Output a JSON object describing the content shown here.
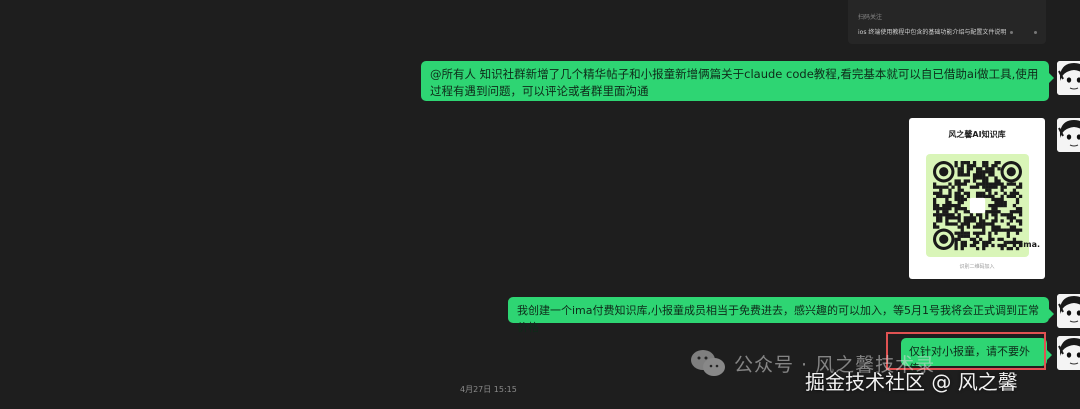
{
  "colors": {
    "bubble": "#2ed573",
    "background": "#1e1e1e",
    "highlight": "#e05252"
  },
  "link_card": {
    "source": "扫码关注",
    "title": "ios 终端使用教程中包含的基础功能介绍与配置文件说明"
  },
  "messages": [
    {
      "type": "text",
      "text": "@所有人 知识社群新增了几个精华帖子和小报童新增俩篇关于claude code教程,看完基本就可以自已借助ai做工具,使用过程有遇到问题，可以评论或者群里面沟通"
    },
    {
      "type": "image",
      "qr_title": "风之馨AI知识库",
      "logo": "ima.",
      "footer": "识别二维码加入"
    },
    {
      "type": "text",
      "text": "我创建一个ima付费知识库,小报童成员相当于免费进去，感兴趣的可以加入，等5月1号我将会正式调到正常价格"
    },
    {
      "type": "text",
      "text": "仅针对小报童，请不要外传"
    }
  ],
  "timestamp": "4月27日 15:15",
  "watermarks": {
    "wechat": "公众号 · 风之馨技术录",
    "juejin": "掘金技术社区 @ 风之馨"
  },
  "icons": {
    "avatar": "manga-face-avatar-icon",
    "wechat": "wechat-logo-icon"
  }
}
